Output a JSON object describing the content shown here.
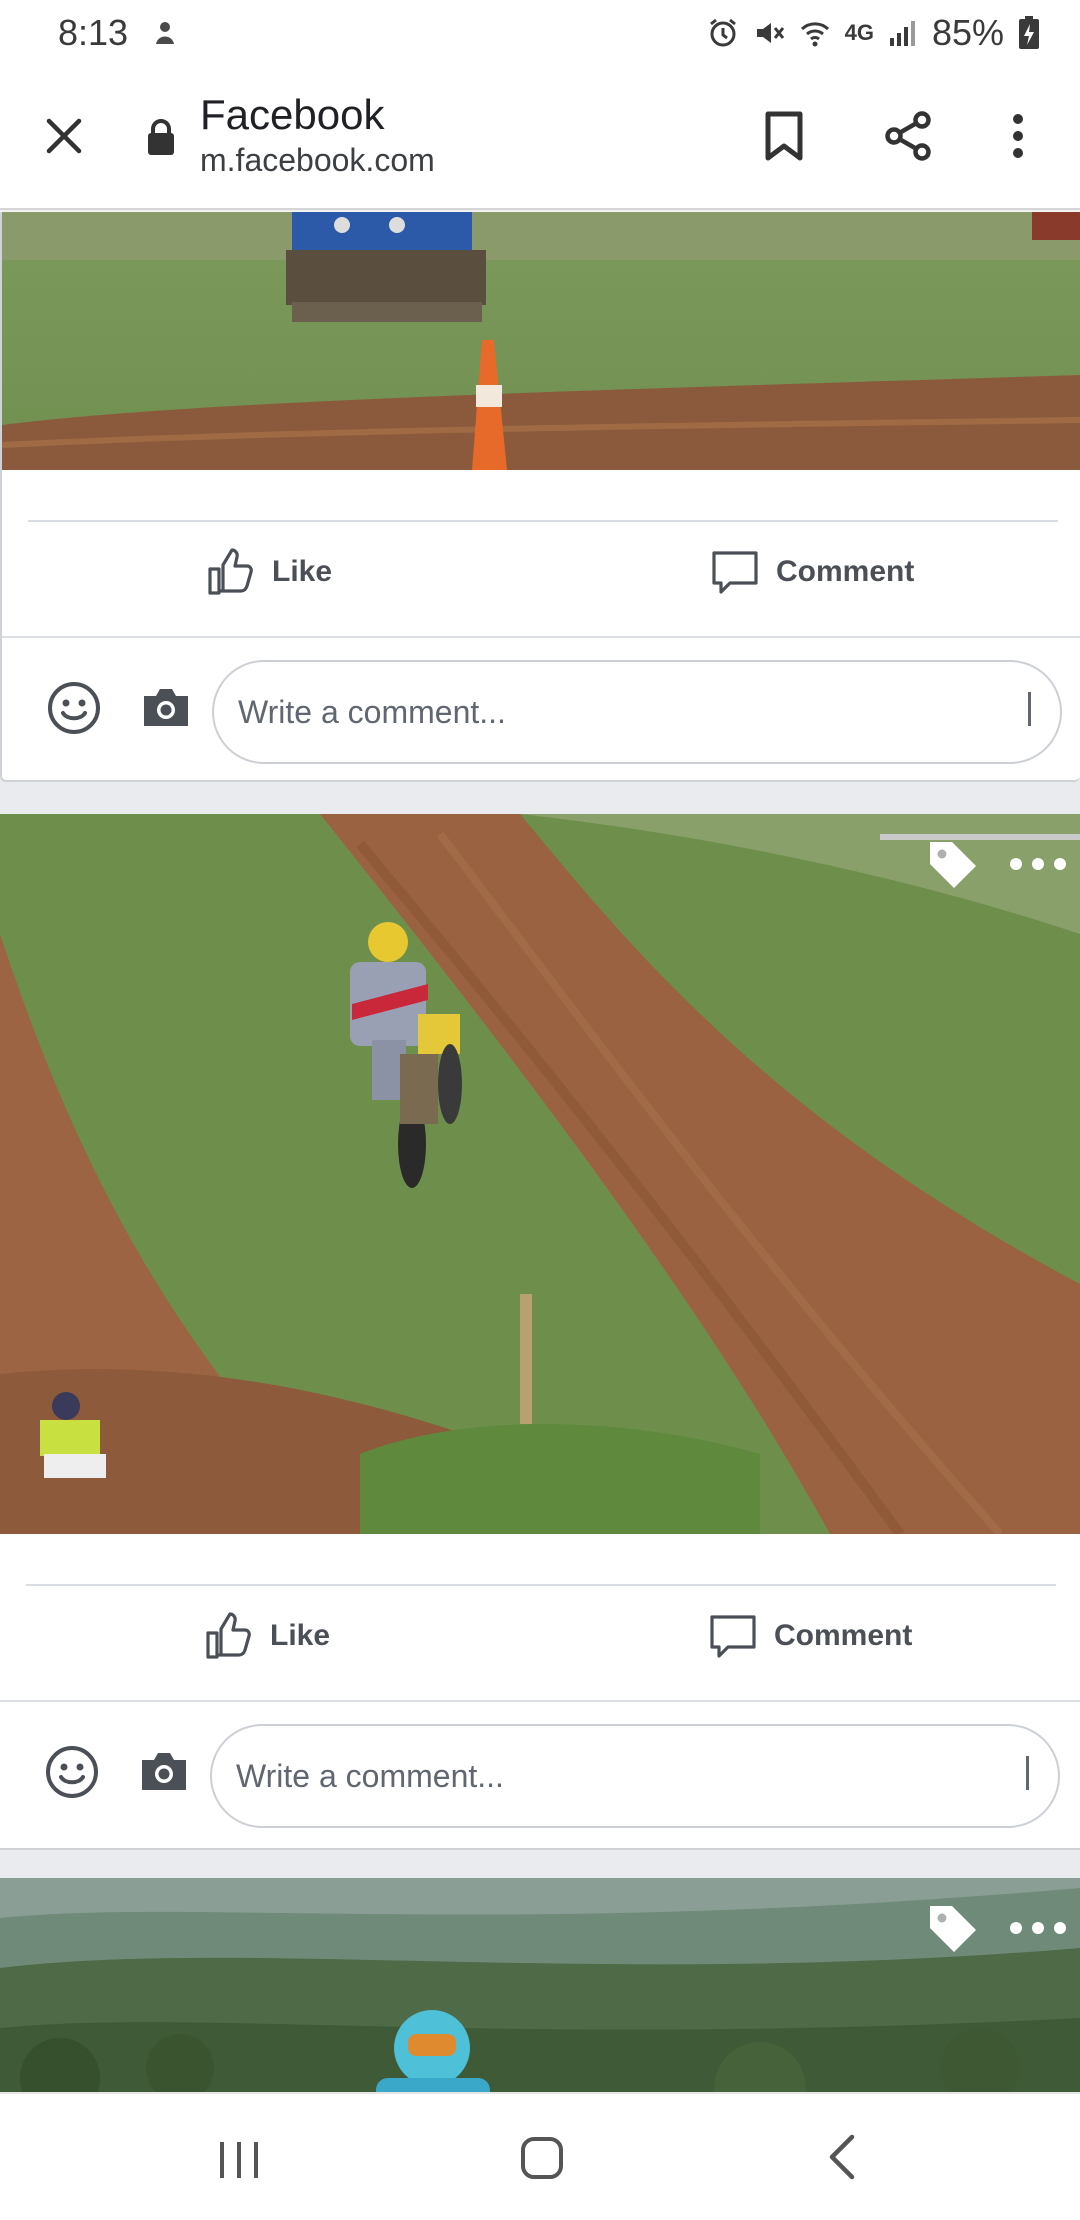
{
  "status_bar": {
    "time": "8:13",
    "network": "4G",
    "battery": "85%",
    "icons": [
      "alarm-icon",
      "mute-icon",
      "wifi-calling-icon",
      "lte-icon",
      "signal-icon",
      "battery-charging-icon"
    ]
  },
  "browser": {
    "title": "Facebook",
    "url": "m.facebook.com",
    "icons": [
      "close-icon",
      "lock-icon",
      "bookmark-icon",
      "share-icon",
      "more-vert-icon"
    ]
  },
  "posts": [
    {
      "photo": "tractor and cone on dirt track",
      "actions": {
        "like_label": "Like",
        "comment_label": "Comment"
      },
      "composer": {
        "placeholder": "Write a comment..."
      }
    },
    {
      "photo": "motocross rider jumping on dirt hill",
      "actions": {
        "like_label": "Like",
        "comment_label": "Comment"
      },
      "composer": {
        "placeholder": "Write a comment..."
      }
    },
    {
      "photo": "rider with blue helmet in front of hills"
    }
  ],
  "colors": {
    "feed_bg": "#e9ebee",
    "action_text": "#4b4f56",
    "icon_gray": "#606770"
  },
  "nav_bar": {
    "icons": [
      "recents-icon",
      "home-icon",
      "back-icon"
    ]
  }
}
